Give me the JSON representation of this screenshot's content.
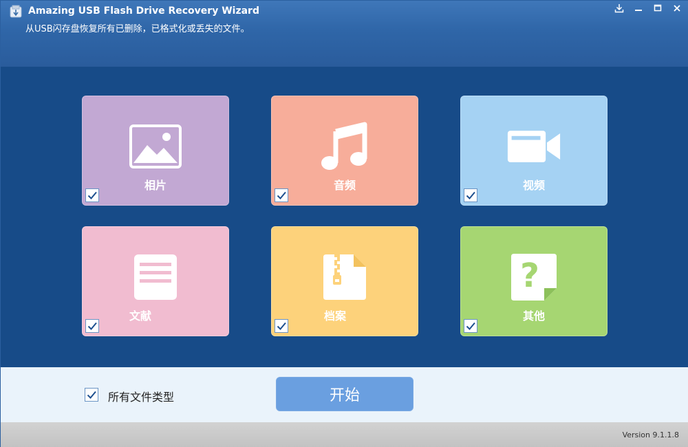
{
  "window": {
    "title": "Amazing USB Flash Drive Recovery Wizard",
    "subtitle": "从USB闪存盘恢复所有已删除，已格式化或丢失的文件。"
  },
  "window_controls": [
    {
      "name": "download-icon"
    },
    {
      "name": "minimize-icon"
    },
    {
      "name": "maximize-icon"
    },
    {
      "name": "close-icon"
    }
  ],
  "tiles": [
    {
      "label": "相片",
      "icon": "image-icon",
      "color": "#c2a8d3",
      "checked": true
    },
    {
      "label": "音频",
      "icon": "music-note-icon",
      "color": "#f7ad9a",
      "checked": true
    },
    {
      "label": "视频",
      "icon": "video-camera-icon",
      "color": "#a5d2f3",
      "checked": true
    },
    {
      "label": "文献",
      "icon": "document-icon",
      "color": "#f1bcd0",
      "checked": true
    },
    {
      "label": "档案",
      "icon": "zip-archive-icon",
      "color": "#fdd27b",
      "checked": true
    },
    {
      "label": "其他",
      "icon": "question-file-icon",
      "color": "#a6d672",
      "checked": true
    }
  ],
  "footer": {
    "all_types_label": "所有文件类型",
    "all_types_checked": true,
    "start_label": "开始"
  },
  "status": {
    "version": "Version 9.1.1.8"
  },
  "colors": {
    "header": "#2f66a8",
    "main": "#174b88",
    "start_button": "#6a9fe0",
    "footer": "#eaf3fb"
  }
}
